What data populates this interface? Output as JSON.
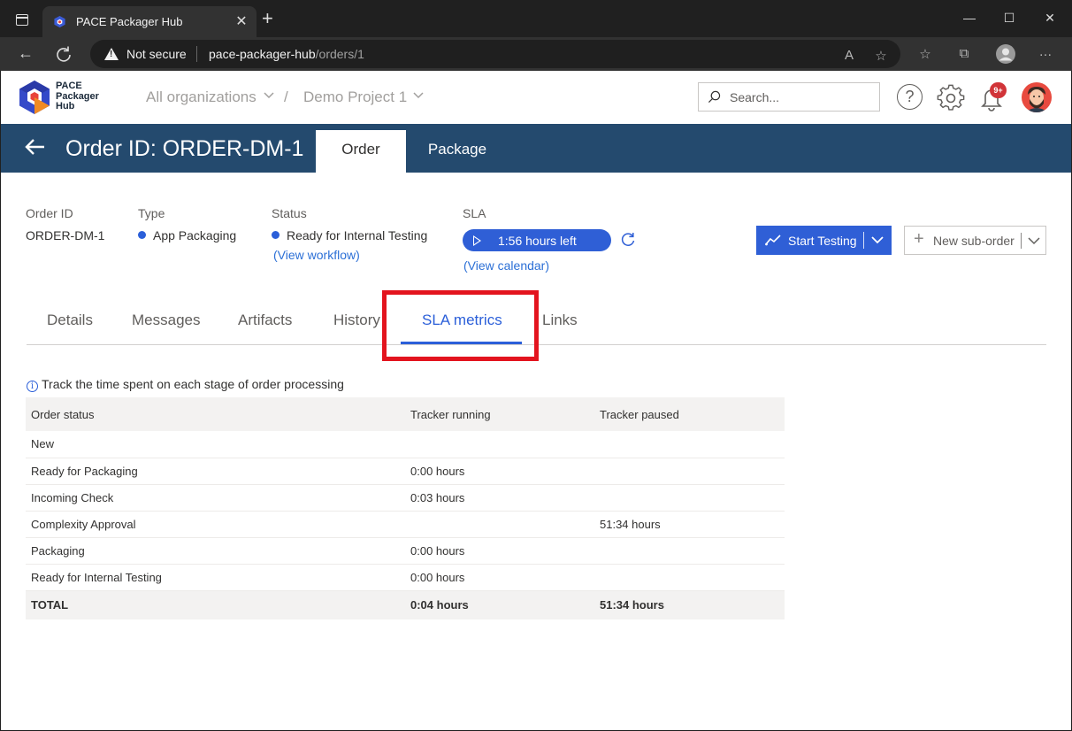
{
  "browser": {
    "tab_title": "PACE Packager Hub",
    "security": "Not secure",
    "url_host": "pace-packager-hub",
    "url_path": "/orders/1"
  },
  "header": {
    "logo_line1": "PACE",
    "logo_line2": "Packager",
    "logo_line3": "Hub",
    "breadcrumb_org": "All organizations",
    "breadcrumb_sep": "/",
    "breadcrumb_project": "Demo Project 1",
    "search_placeholder": "Search...",
    "help_symbol": "?",
    "notification_badge": "9+"
  },
  "banner": {
    "title": "Order ID: ORDER-DM-1",
    "tabs": [
      "Order",
      "Package"
    ]
  },
  "meta": {
    "order_id_label": "Order ID",
    "order_id_value": "ORDER-DM-1",
    "type_label": "Type",
    "type_value": "App Packaging",
    "status_label": "Status",
    "status_value": "Ready for Internal Testing",
    "workflow_link": "(View workflow)",
    "sla_label": "SLA",
    "sla_value": "1:56 hours left",
    "calendar_link": "(View calendar)"
  },
  "actions": {
    "start_testing": "Start Testing",
    "new_sub_order": "New sub-order"
  },
  "subtabs": [
    "Details",
    "Messages",
    "Artifacts",
    "History",
    "SLA metrics",
    "Links"
  ],
  "sla_metrics": {
    "info": "Track the time spent on each stage of order processing",
    "columns": [
      "Order status",
      "Tracker running",
      "Tracker paused"
    ],
    "rows": [
      [
        "New",
        "",
        ""
      ],
      [
        "Ready for Packaging",
        "0:00 hours",
        ""
      ],
      [
        "Incoming Check",
        "0:03 hours",
        ""
      ],
      [
        "Complexity Approval",
        "",
        "51:34 hours"
      ],
      [
        "Packaging",
        "0:00 hours",
        ""
      ],
      [
        "Ready for Internal Testing",
        "0:00 hours",
        ""
      ]
    ],
    "total": [
      "TOTAL",
      "0:04 hours",
      "51:34 hours"
    ]
  },
  "colors": {
    "banner": "#244a6e",
    "accent": "#2f5fd6",
    "highlight": "#e3141e"
  }
}
